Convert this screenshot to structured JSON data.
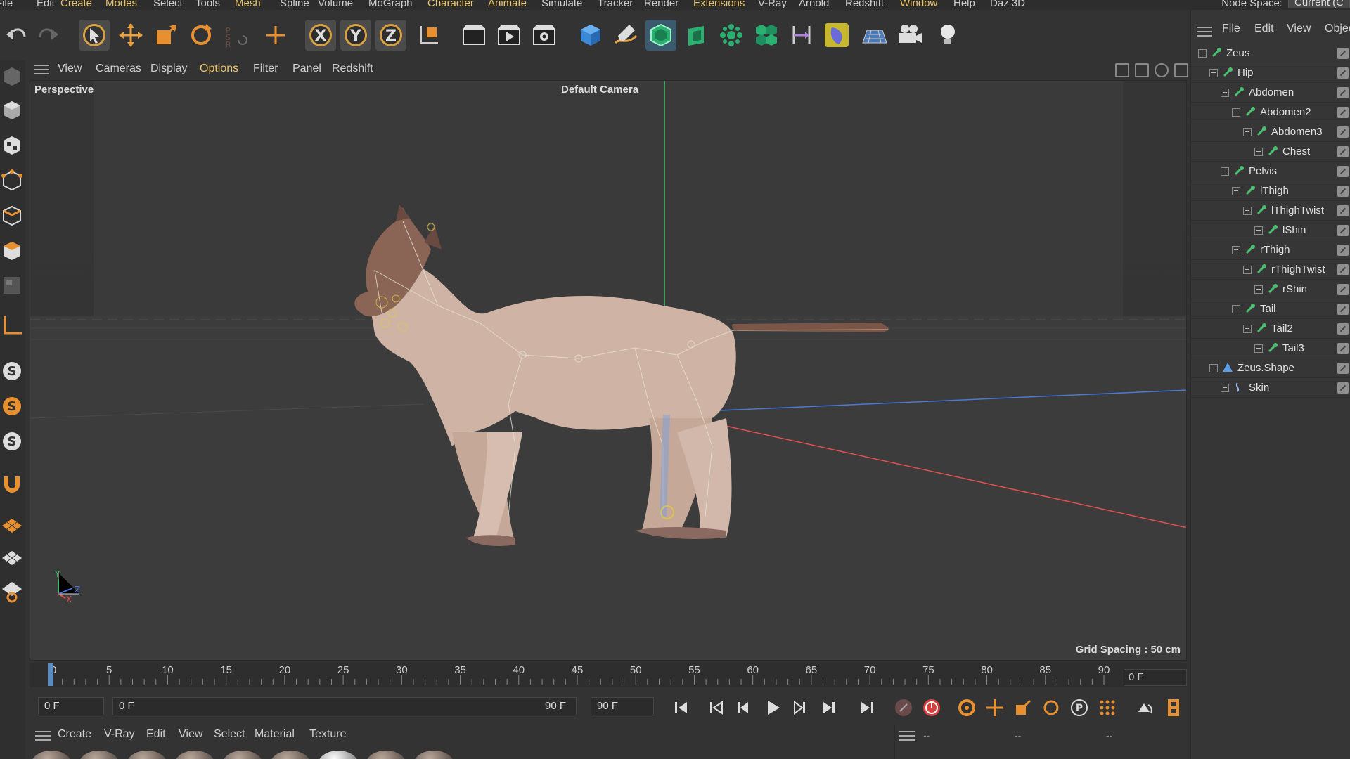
{
  "menubar": {
    "items": [
      "File",
      "Edit",
      "Create",
      "Modes",
      "Select",
      "Tools",
      "Mesh",
      "Spline",
      "Volume",
      "MoGraph",
      "Character",
      "Animate",
      "Simulate",
      "Tracker",
      "Render",
      "Extensions",
      "V-Ray",
      "Arnold",
      "Redshift",
      "Window",
      "Help",
      "Daz 3D"
    ],
    "highlighted": [
      "Create",
      "Modes",
      "Mesh",
      "Character",
      "Animate",
      "Extensions",
      "Window"
    ],
    "node_space_label": "Node Space:",
    "node_space_value": "Current (C"
  },
  "toolbar": {
    "icons": [
      "undo-icon",
      "redo-icon",
      "select-arrow-icon",
      "move-icon",
      "scale-icon",
      "rotate-icon",
      "psr-icon",
      "add-axis-icon",
      "x-axis-icon",
      "y-axis-icon",
      "z-axis-icon",
      "coordinate-system-icon",
      "render-region-icon",
      "render-view-icon",
      "render-settings-icon",
      "cube-icon",
      "pen-icon",
      "subdivision-icon",
      "extrude-icon",
      "cloner-icon",
      "array-icon",
      "deformer-icon",
      "scene-icon",
      "floor-icon",
      "camera-icon",
      "light-icon"
    ],
    "axis_labels": [
      "X",
      "Y",
      "Z"
    ]
  },
  "viewport_menu": {
    "items": [
      "View",
      "Cameras",
      "Display",
      "Options",
      "Filter",
      "Panel",
      "Redshift"
    ],
    "highlighted": [
      "Options"
    ]
  },
  "viewport": {
    "projection": "Perspective",
    "camera": "Default Camera",
    "grid_spacing": "Grid Spacing : 50 cm",
    "axis_labels": [
      "Y",
      "X",
      "Z"
    ],
    "colors": {
      "x_axis": "#e05050",
      "y_axis": "#3ec06a",
      "z_axis": "#4a78d8"
    }
  },
  "timeline": {
    "ticks": [
      "0",
      "5",
      "10",
      "15",
      "20",
      "25",
      "30",
      "35",
      "40",
      "45",
      "50",
      "55",
      "60",
      "65",
      "70",
      "75",
      "80",
      "85",
      "90"
    ],
    "current_frame": "0 F",
    "playhead_frame": 0
  },
  "transport": {
    "start_field": "0 F",
    "range_start": "0 F",
    "range_end": "90 F",
    "end_field": "90 F",
    "buttons": [
      "go-start-icon",
      "prev-key-icon",
      "prev-frame-icon",
      "play-icon",
      "next-frame-icon",
      "next-key-icon",
      "go-end-icon",
      "record-icon",
      "autokey-icon",
      "keyframe-selection-icon",
      "position-key-icon",
      "scale-key-icon",
      "rotation-key-icon",
      "param-key-icon",
      "point-level-icon",
      "schedule-icon",
      "timeline-icon"
    ]
  },
  "material_manager": {
    "menu": [
      "Create",
      "V-Ray",
      "Edit",
      "View",
      "Select",
      "Material",
      "Texture"
    ],
    "material_count": 9
  },
  "attributes": {
    "placeholders": [
      "--",
      "--",
      "--"
    ]
  },
  "object_manager": {
    "menu": [
      "File",
      "Edit",
      "View",
      "Objec"
    ],
    "objects": [
      {
        "name": "Zeus",
        "depth": 0,
        "icon": "joint-icon"
      },
      {
        "name": "Hip",
        "depth": 1,
        "icon": "joint-icon"
      },
      {
        "name": "Abdomen",
        "depth": 2,
        "icon": "joint-icon"
      },
      {
        "name": "Abdomen2",
        "depth": 3,
        "icon": "joint-icon"
      },
      {
        "name": "Abdomen3",
        "depth": 4,
        "icon": "joint-icon"
      },
      {
        "name": "Chest",
        "depth": 5,
        "icon": "joint-icon"
      },
      {
        "name": "Pelvis",
        "depth": 2,
        "icon": "joint-icon"
      },
      {
        "name": "lThigh",
        "depth": 3,
        "icon": "joint-icon"
      },
      {
        "name": "lThighTwist",
        "depth": 4,
        "icon": "joint-icon"
      },
      {
        "name": "lShin",
        "depth": 5,
        "icon": "joint-icon"
      },
      {
        "name": "rThigh",
        "depth": 3,
        "icon": "joint-icon"
      },
      {
        "name": "rThighTwist",
        "depth": 4,
        "icon": "joint-icon"
      },
      {
        "name": "rShin",
        "depth": 5,
        "icon": "joint-icon"
      },
      {
        "name": "Tail",
        "depth": 3,
        "icon": "joint-icon"
      },
      {
        "name": "Tail2",
        "depth": 4,
        "icon": "joint-icon"
      },
      {
        "name": "Tail3",
        "depth": 5,
        "icon": "joint-icon"
      },
      {
        "name": "Zeus.Shape",
        "depth": 1,
        "icon": "polygon-object-icon"
      },
      {
        "name": "Skin",
        "depth": 2,
        "icon": "skin-deformer-icon"
      }
    ]
  }
}
